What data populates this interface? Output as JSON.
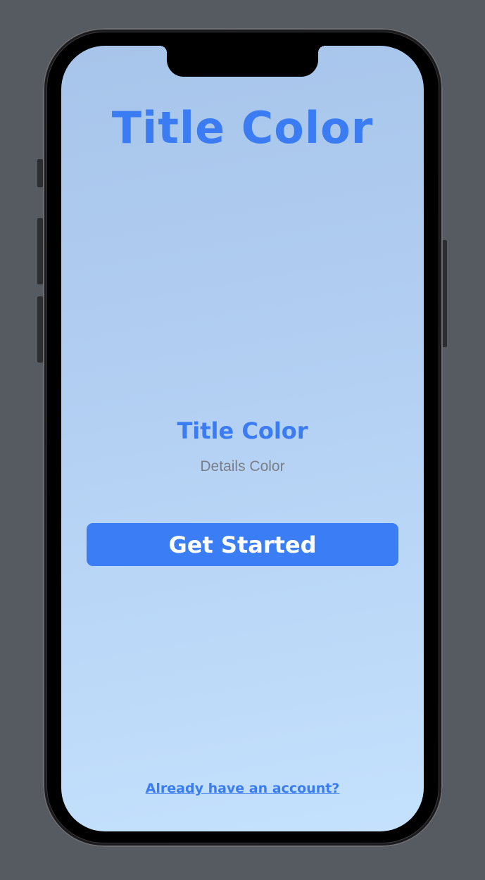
{
  "screen": {
    "hero_title": "Title Color",
    "sub_title": "Title Color",
    "details": "Details Color",
    "cta_label": "Get Started",
    "account_link": "Already have an account?"
  },
  "colors": {
    "accent": "#3b7cf2",
    "button_bg": "#3a7df4",
    "details_text": "#7a7f88",
    "background_top": "#a7c4ea",
    "background_bottom": "#c4e1fd"
  }
}
